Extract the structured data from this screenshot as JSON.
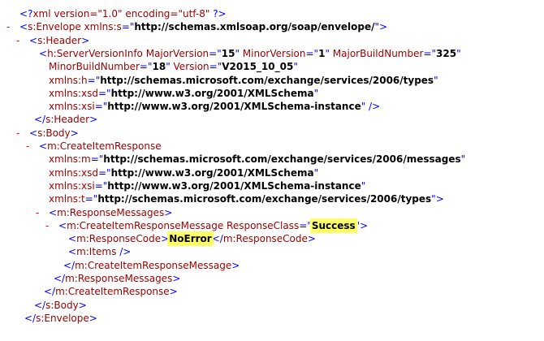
{
  "xml_lines": [
    {
      "indent": 0,
      "toggle": "",
      "segments": [
        {
          "t": "mark",
          "v": "<?"
        },
        {
          "t": "tag",
          "v": "xml version=\"1.0\" encoding=\"utf-8\" "
        },
        {
          "t": "mark",
          "v": "?>"
        }
      ]
    },
    {
      "indent": 0,
      "toggle": "-",
      "segments": [
        {
          "t": "mark",
          "v": "<"
        },
        {
          "t": "tag",
          "v": "s:Envelope "
        },
        {
          "t": "attr",
          "v": "xmlns:s"
        },
        {
          "t": "mark",
          "v": "=\""
        },
        {
          "t": "val",
          "v": "http://schemas.xmlsoap.org/soap/envelope/"
        },
        {
          "t": "mark",
          "v": "\">"
        }
      ]
    },
    {
      "indent": 1,
      "toggle": "-",
      "segments": [
        {
          "t": "mark",
          "v": "<"
        },
        {
          "t": "tag",
          "v": "s:Header"
        },
        {
          "t": "mark",
          "v": ">"
        }
      ]
    },
    {
      "indent": 2,
      "toggle": "",
      "segments": [
        {
          "t": "mark",
          "v": "<"
        },
        {
          "t": "tag",
          "v": "h:ServerVersionInfo "
        },
        {
          "t": "attr",
          "v": "MajorVersion"
        },
        {
          "t": "mark",
          "v": "=\""
        },
        {
          "t": "val",
          "v": "15"
        },
        {
          "t": "mark",
          "v": "\" "
        },
        {
          "t": "attr",
          "v": "MinorVersion"
        },
        {
          "t": "mark",
          "v": "=\""
        },
        {
          "t": "val",
          "v": "1"
        },
        {
          "t": "mark",
          "v": "\" "
        },
        {
          "t": "attr",
          "v": "MajorBuildNumber"
        },
        {
          "t": "mark",
          "v": "=\""
        },
        {
          "t": "val",
          "v": "325"
        },
        {
          "t": "mark",
          "v": "\""
        }
      ]
    },
    {
      "indent": 3,
      "toggle": "",
      "segments": [
        {
          "t": "attr",
          "v": "MinorBuildNumber"
        },
        {
          "t": "mark",
          "v": "=\""
        },
        {
          "t": "val",
          "v": "18"
        },
        {
          "t": "mark",
          "v": "\" "
        },
        {
          "t": "attr",
          "v": "Version"
        },
        {
          "t": "mark",
          "v": "=\""
        },
        {
          "t": "val",
          "v": "V2015_10_05"
        },
        {
          "t": "mark",
          "v": "\""
        }
      ]
    },
    {
      "indent": 3,
      "toggle": "",
      "segments": [
        {
          "t": "attr",
          "v": "xmlns:h"
        },
        {
          "t": "mark",
          "v": "=\""
        },
        {
          "t": "val",
          "v": "http://schemas.microsoft.com/exchange/services/2006/types"
        },
        {
          "t": "mark",
          "v": "\""
        }
      ]
    },
    {
      "indent": 3,
      "toggle": "",
      "segments": [
        {
          "t": "attr",
          "v": "xmlns:xsd"
        },
        {
          "t": "mark",
          "v": "=\""
        },
        {
          "t": "val",
          "v": "http://www.w3.org/2001/XMLSchema"
        },
        {
          "t": "mark",
          "v": "\""
        }
      ]
    },
    {
      "indent": 3,
      "toggle": "",
      "segments": [
        {
          "t": "attr",
          "v": "xmlns:xsi"
        },
        {
          "t": "mark",
          "v": "=\""
        },
        {
          "t": "val",
          "v": "http://www.w3.org/2001/XMLSchema-instance"
        },
        {
          "t": "mark",
          "v": "\" />"
        }
      ]
    },
    {
      "indent": 1.5,
      "toggle": "",
      "segments": [
        {
          "t": "mark",
          "v": "</"
        },
        {
          "t": "tag",
          "v": "s:Header"
        },
        {
          "t": "mark",
          "v": ">"
        }
      ]
    },
    {
      "indent": 1,
      "toggle": "-",
      "segments": [
        {
          "t": "mark",
          "v": "<"
        },
        {
          "t": "tag",
          "v": "s:Body"
        },
        {
          "t": "mark",
          "v": ">"
        }
      ]
    },
    {
      "indent": 2,
      "toggle": "-",
      "segments": [
        {
          "t": "mark",
          "v": "<"
        },
        {
          "t": "tag",
          "v": "m:CreateItemResponse"
        }
      ]
    },
    {
      "indent": 3,
      "toggle": "",
      "segments": [
        {
          "t": "attr",
          "v": "xmlns:m"
        },
        {
          "t": "mark",
          "v": "=\""
        },
        {
          "t": "val",
          "v": "http://schemas.microsoft.com/exchange/services/2006/messages"
        },
        {
          "t": "mark",
          "v": "\""
        }
      ]
    },
    {
      "indent": 3,
      "toggle": "",
      "segments": [
        {
          "t": "attr",
          "v": "xmlns:xsd"
        },
        {
          "t": "mark",
          "v": "=\""
        },
        {
          "t": "val",
          "v": "http://www.w3.org/2001/XMLSchema"
        },
        {
          "t": "mark",
          "v": "\""
        }
      ]
    },
    {
      "indent": 3,
      "toggle": "",
      "segments": [
        {
          "t": "attr",
          "v": "xmlns:xsi"
        },
        {
          "t": "mark",
          "v": "=\""
        },
        {
          "t": "val",
          "v": "http://www.w3.org/2001/XMLSchema-instance"
        },
        {
          "t": "mark",
          "v": "\""
        }
      ]
    },
    {
      "indent": 3,
      "toggle": "",
      "segments": [
        {
          "t": "attr",
          "v": "xmlns:t"
        },
        {
          "t": "mark",
          "v": "=\""
        },
        {
          "t": "val",
          "v": "http://schemas.microsoft.com/exchange/services/2006/types"
        },
        {
          "t": "mark",
          "v": "\">"
        }
      ]
    },
    {
      "indent": 3,
      "toggle": "-",
      "segments": [
        {
          "t": "mark",
          "v": "<"
        },
        {
          "t": "tag",
          "v": "m:ResponseMessages"
        },
        {
          "t": "mark",
          "v": ">"
        }
      ]
    },
    {
      "indent": 4,
      "toggle": "-",
      "segments": [
        {
          "t": "mark",
          "v": "<"
        },
        {
          "t": "tag",
          "v": "m:CreateItemResponseMessage "
        },
        {
          "t": "attr",
          "v": "ResponseClass"
        },
        {
          "t": "mark",
          "v": "=\""
        },
        {
          "t": "val",
          "v": "Success",
          "hl": true
        },
        {
          "t": "mark",
          "v": "\">"
        }
      ]
    },
    {
      "indent": 5,
      "toggle": "",
      "segments": [
        {
          "t": "mark",
          "v": "<"
        },
        {
          "t": "tag",
          "v": "m:ResponseCode"
        },
        {
          "t": "mark",
          "v": ">"
        },
        {
          "t": "val",
          "v": "NoError",
          "hl": true
        },
        {
          "t": "mark",
          "v": "</"
        },
        {
          "t": "tag",
          "v": "m:ResponseCode"
        },
        {
          "t": "mark",
          "v": ">"
        }
      ]
    },
    {
      "indent": 5,
      "toggle": "",
      "segments": [
        {
          "t": "mark",
          "v": "<"
        },
        {
          "t": "tag",
          "v": "m:Items "
        },
        {
          "t": "mark",
          "v": "/>"
        }
      ]
    },
    {
      "indent": 4.5,
      "toggle": "",
      "segments": [
        {
          "t": "mark",
          "v": "</"
        },
        {
          "t": "tag",
          "v": "m:CreateItemResponseMessage"
        },
        {
          "t": "mark",
          "v": ">"
        }
      ]
    },
    {
      "indent": 3.5,
      "toggle": "",
      "segments": [
        {
          "t": "mark",
          "v": "</"
        },
        {
          "t": "tag",
          "v": "m:ResponseMessages"
        },
        {
          "t": "mark",
          "v": ">"
        }
      ]
    },
    {
      "indent": 2.5,
      "toggle": "",
      "segments": [
        {
          "t": "mark",
          "v": "</"
        },
        {
          "t": "tag",
          "v": "m:CreateItemResponse"
        },
        {
          "t": "mark",
          "v": ">"
        }
      ]
    },
    {
      "indent": 1.5,
      "toggle": "",
      "segments": [
        {
          "t": "mark",
          "v": "</"
        },
        {
          "t": "tag",
          "v": "s:Body"
        },
        {
          "t": "mark",
          "v": ">"
        }
      ]
    },
    {
      "indent": 0.5,
      "toggle": "",
      "segments": [
        {
          "t": "mark",
          "v": "</"
        },
        {
          "t": "tag",
          "v": "s:Envelope"
        },
        {
          "t": "mark",
          "v": ">"
        }
      ]
    }
  ]
}
